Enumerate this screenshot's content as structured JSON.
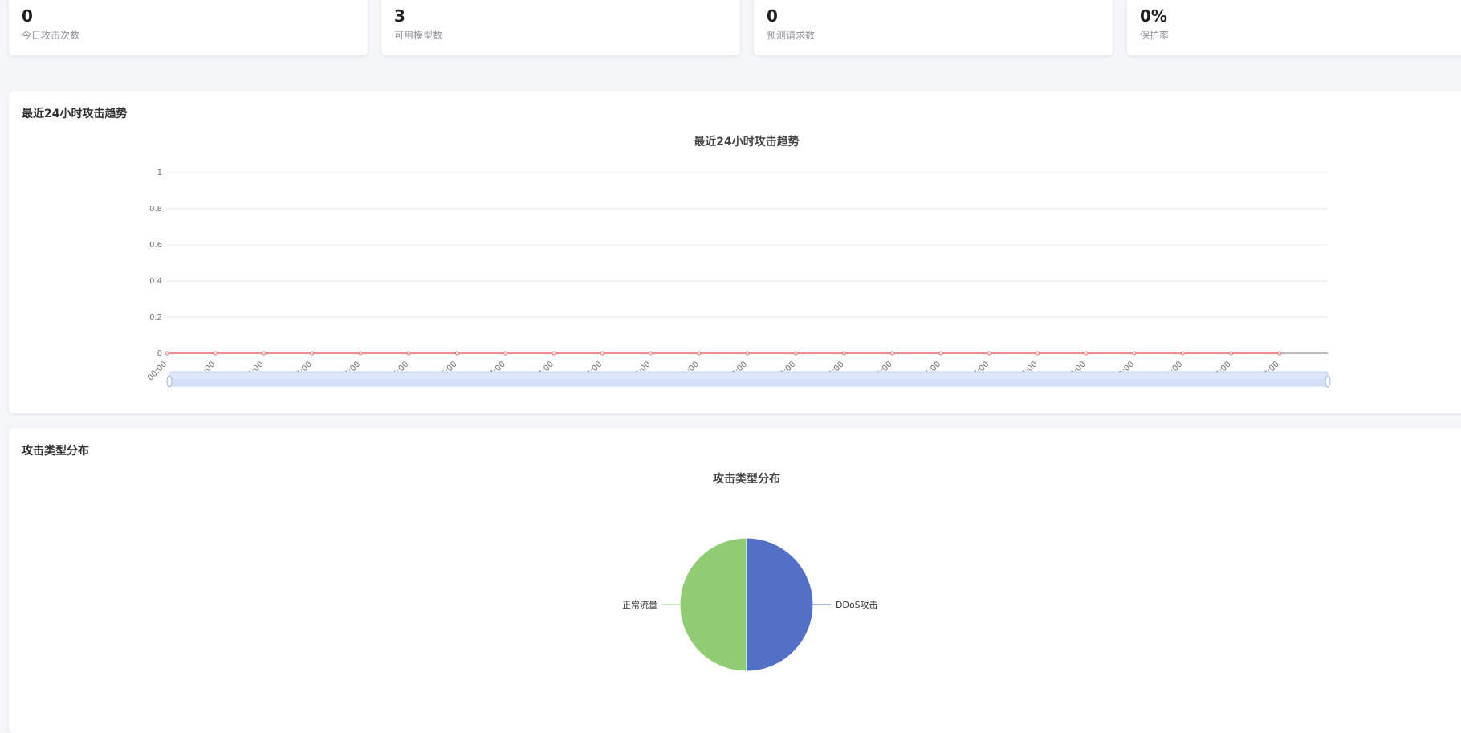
{
  "stats": [
    {
      "value": "0",
      "label": "今日攻击次数"
    },
    {
      "value": "3",
      "label": "可用模型数"
    },
    {
      "value": "0",
      "label": "预测请求数"
    },
    {
      "value": "0%",
      "label": "保护率"
    }
  ],
  "trend_panel": {
    "title": "最近24小时攻击趋势"
  },
  "type_panel": {
    "title": "攻击类型分布"
  },
  "colors": {
    "line": "#ee6666",
    "pie_ddos": "#5470c6",
    "pie_normal": "#91cc75",
    "zoom": "#d4e0f9"
  },
  "chart_data": [
    {
      "type": "line",
      "title": "最近24小时攻击趋势",
      "x": [
        "00:00",
        "01:00",
        "02:00",
        "03:00",
        "04:00",
        "05:00",
        "06:00",
        "07:00",
        "08:00",
        "09:00",
        "10:00",
        "11:00",
        "12:00",
        "13:00",
        "14:00",
        "15:00",
        "16:00",
        "17:00",
        "18:00",
        "19:00",
        "20:00",
        "21:00",
        "22:00",
        "23:00"
      ],
      "series": [
        {
          "values": [
            0,
            0,
            0,
            0,
            0,
            0,
            0,
            0,
            0,
            0,
            0,
            0,
            0,
            0,
            0,
            0,
            0,
            0,
            0,
            0,
            0,
            0,
            0,
            0
          ]
        }
      ],
      "yticks": [
        "0",
        "0.2",
        "0.4",
        "0.6",
        "0.8",
        "1"
      ],
      "ylim": [
        0,
        1
      ],
      "grid": true
    },
    {
      "type": "pie",
      "title": "攻击类型分布",
      "labels": [
        "DDoS攻击",
        "正常流量"
      ],
      "values": [
        50,
        50
      ]
    }
  ]
}
